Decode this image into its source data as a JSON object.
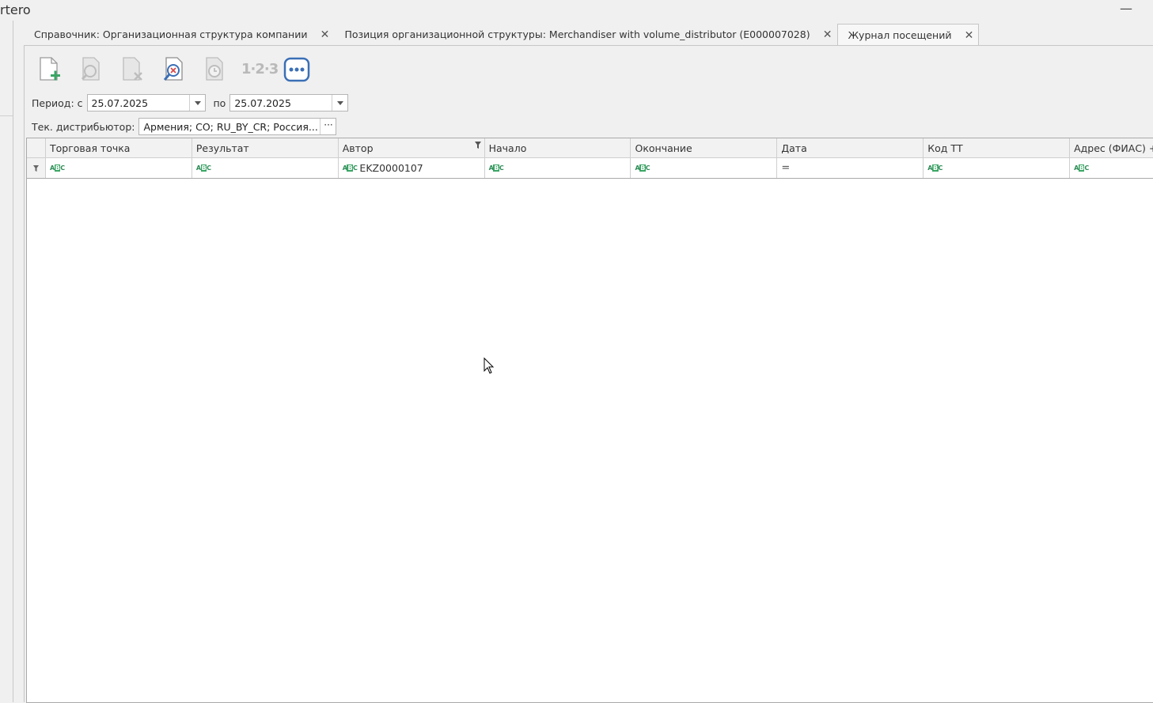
{
  "app": {
    "title": "rtero"
  },
  "tabs": [
    {
      "label": "Справочник: Организационная структура компании",
      "active": false
    },
    {
      "label": "Позиция организационной структуры:  Merchandiser with volume_distributor (E000007028)",
      "active": false
    },
    {
      "label": "Журнал посещений",
      "active": true
    }
  ],
  "toolbar": {
    "items": [
      {
        "icon": "new-document-icon"
      },
      {
        "icon": "search-document-icon"
      },
      {
        "icon": "delete-document-icon"
      },
      {
        "icon": "search-cancel-icon"
      },
      {
        "icon": "history-clock-icon"
      },
      {
        "icon": "numbering-icon",
        "text": "1·2·3"
      },
      {
        "icon": "more-icon"
      }
    ]
  },
  "filters": {
    "period_label": "Период: с",
    "date_from": "25.07.2025",
    "to_label": "по",
    "date_to": "25.07.2025",
    "distributor_label": "Тек. дистрибьютор:",
    "distributor_value": "Армения; CO; RU_BY_CR; Россия..."
  },
  "grid": {
    "columns": [
      {
        "header": "Торговая точка",
        "filter": ""
      },
      {
        "header": "Результат",
        "filter": ""
      },
      {
        "header": "Автор",
        "filter": "EKZ0000107",
        "has_filter": true
      },
      {
        "header": "Начало",
        "filter": ""
      },
      {
        "header": "Окончание",
        "filter": ""
      },
      {
        "header": "Дата",
        "filter": "="
      },
      {
        "header": "Код ТТ",
        "filter": ""
      },
      {
        "header": "Адрес (ФИАС) +",
        "filter": ""
      }
    ],
    "abc_glyph": {
      "a": "A",
      "b": "B",
      "c": "C"
    }
  }
}
